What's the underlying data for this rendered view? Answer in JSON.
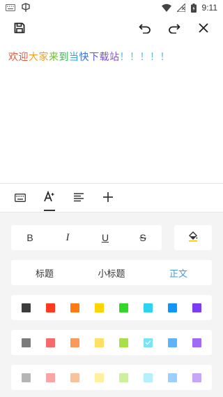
{
  "status_bar": {
    "time": "9:11"
  },
  "editor": {
    "segments": [
      {
        "text": "欢",
        "color": "#e8553d"
      },
      {
        "text": "迎",
        "color": "#e8553d"
      },
      {
        "text": "大",
        "color": "#f0a020"
      },
      {
        "text": "家",
        "color": "#f0a020"
      },
      {
        "text": "来",
        "color": "#6cbf2d"
      },
      {
        "text": "到",
        "color": "#2db84a"
      },
      {
        "text": "当",
        "color": "#2f9fd8"
      },
      {
        "text": "快",
        "color": "#3a6fd8"
      },
      {
        "text": "下",
        "color": "#5a55d6"
      },
      {
        "text": "载",
        "color": "#7a4fd8"
      },
      {
        "text": "站",
        "color": "#8e4fd6"
      },
      {
        "text": "！",
        "color": "#52c2d6"
      },
      {
        "text": "！",
        "color": "#52c2d6"
      },
      {
        "text": "！",
        "color": "#52c2d6"
      },
      {
        "text": "！",
        "color": "#52c2d6"
      },
      {
        "text": "！",
        "color": "#52c2d6"
      }
    ]
  },
  "format_buttons": {
    "bold": "B",
    "italic": "I",
    "underline": "U",
    "strike": "S"
  },
  "paragraph_styles": [
    {
      "label": "标题",
      "active": false
    },
    {
      "label": "小标题",
      "active": false
    },
    {
      "label": "正文",
      "active": true
    }
  ],
  "palette": {
    "row1": [
      "#3d3d3d",
      "#ff3b1f",
      "#ff7a14",
      "#ffd400",
      "#34d629",
      "#2fd3f2",
      "#1296f3",
      "#7a3df0"
    ],
    "row2": [
      "#7a7a7a",
      "#f56a6a",
      "#f99a5a",
      "#ffe066",
      "#a8e04a",
      "#7be3f6",
      "#5fb4f7",
      "#a06af5"
    ],
    "row3": [
      "#b5b5b5",
      "#f9a5a5",
      "#fbc29a",
      "#fff0a0",
      "#cdf09a",
      "#b5f0fb",
      "#9ad0fb",
      "#c6a6f8"
    ],
    "selected": "#7be3f6",
    "accent": "#3d9be9"
  }
}
